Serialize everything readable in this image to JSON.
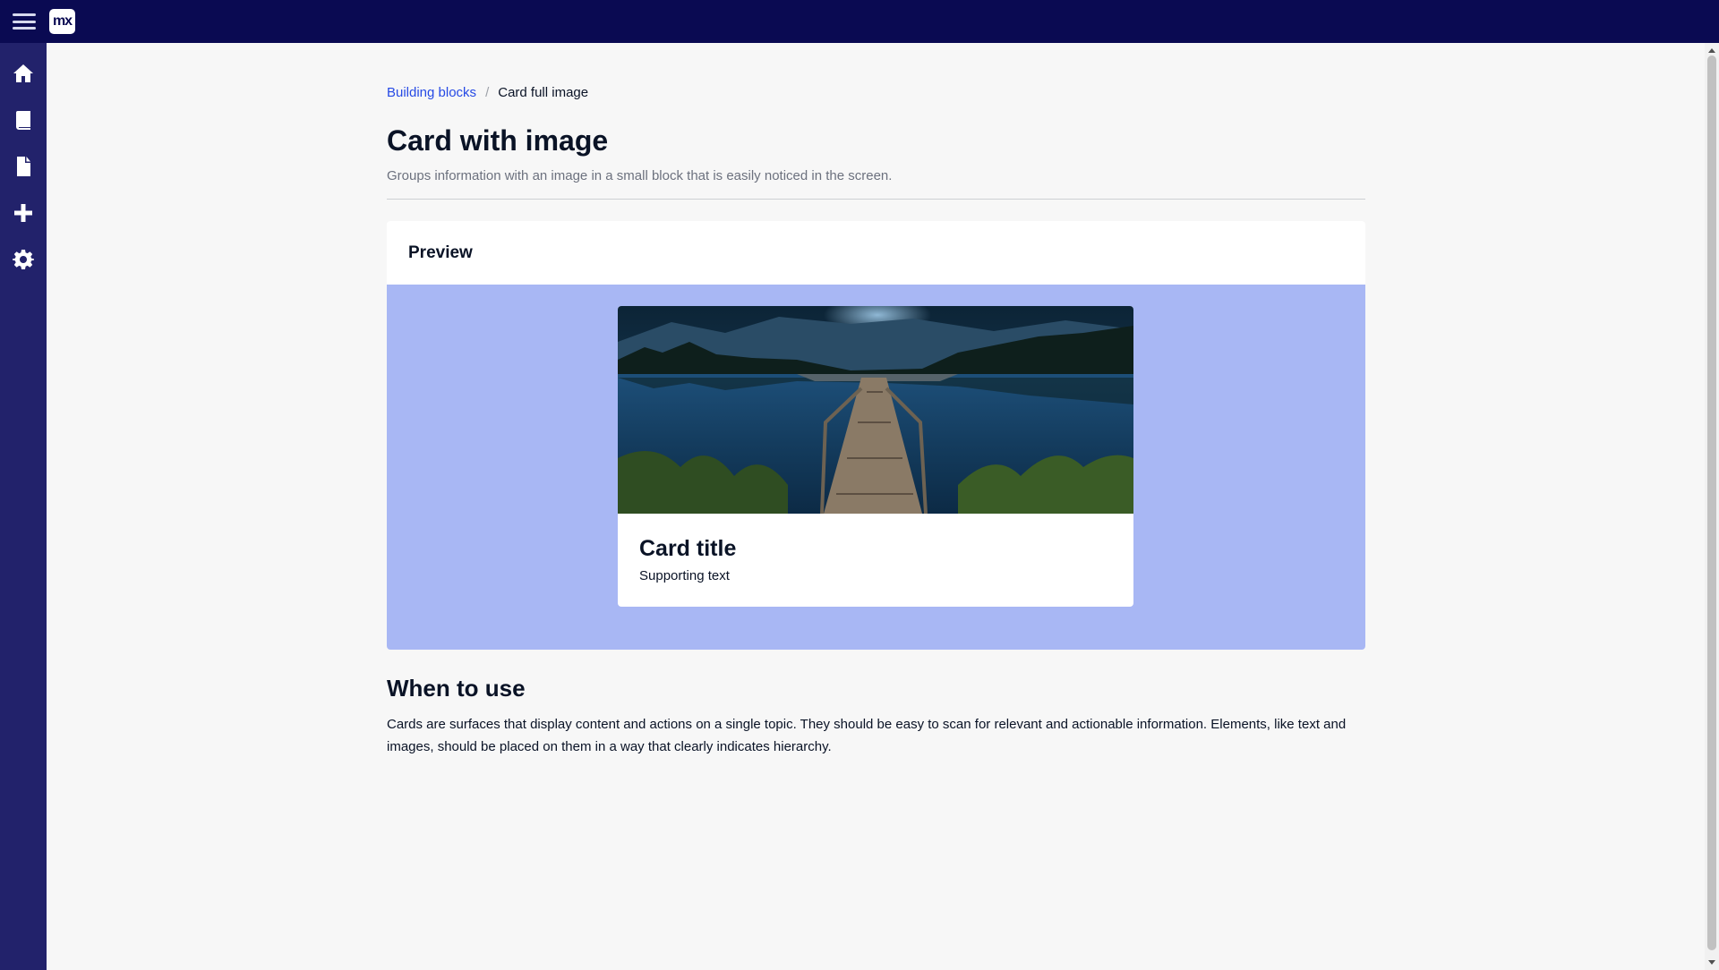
{
  "app": {
    "logo_text": "mx",
    "colors": {
      "topbar": "#0a0a52",
      "sidebar": "#22226b",
      "link": "#264ae5",
      "preview_bg": "#a8b7f4"
    }
  },
  "sidebar": {
    "items": [
      {
        "icon": "home-icon"
      },
      {
        "icon": "book-icon"
      },
      {
        "icon": "file-icon"
      },
      {
        "icon": "plus-icon"
      },
      {
        "icon": "gear-icon"
      }
    ]
  },
  "breadcrumb": {
    "parent": "Building blocks",
    "separator": "/",
    "current": "Card full image"
  },
  "page": {
    "title": "Card with image",
    "subtitle": "Groups information with an image in a small block that is easily noticed in the screen."
  },
  "preview": {
    "header": "Preview",
    "card": {
      "title": "Card title",
      "text": "Supporting text"
    }
  },
  "usage": {
    "title": "When to use",
    "text": "Cards are surfaces that display content and actions on a single topic. They should be easy to scan for relevant and actionable information. Elements, like text and images, should be placed on them in a way that clearly indicates hierarchy."
  }
}
